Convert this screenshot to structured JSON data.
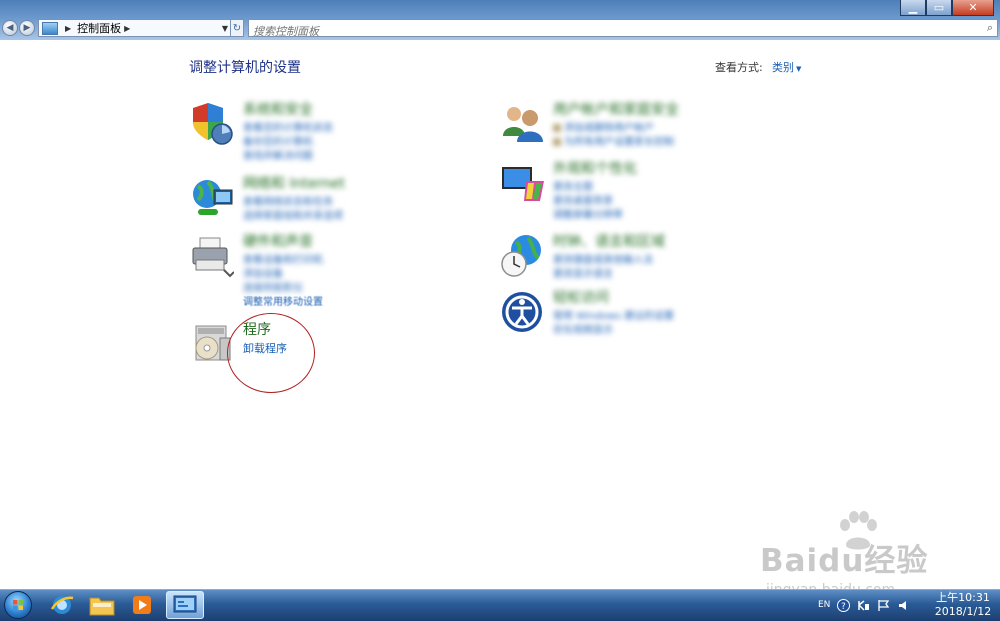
{
  "window": {
    "controls": [
      "minimize",
      "maximize",
      "close"
    ]
  },
  "address_bar": {
    "path": "控制面板",
    "placeholder": "搜索控制面板"
  },
  "header": {
    "title": "调整计算机的设置",
    "view_by_label": "查看方式:",
    "view_by_value": "类别"
  },
  "categories": {
    "security": {
      "title": "系统和安全",
      "links": [
        "查看您的计算机状态",
        "备份您的计算机",
        "查找并解决问题"
      ]
    },
    "network": {
      "title": "网络和 Internet",
      "links": [
        "查看网络状态和任务",
        "选择家庭组和共享选项"
      ]
    },
    "hardware": {
      "title": "硬件和声音",
      "links": [
        "查看设备和打印机",
        "添加设备",
        "连接到投影仪",
        "调整常用移动设置"
      ]
    },
    "programs": {
      "title": "程序",
      "links": [
        "卸载程序"
      ]
    },
    "accounts": {
      "title": "用户帐户和家庭安全",
      "links": [
        "添加或删除用户帐户",
        "为所有用户设置家长控制"
      ]
    },
    "appearance": {
      "title": "外观和个性化",
      "links": [
        "更改主题",
        "更改桌面背景",
        "调整屏幕分辨率"
      ]
    },
    "clock": {
      "title": "时钟、语言和区域",
      "links": [
        "更改键盘或其他输入法",
        "更改显示语言"
      ]
    },
    "ease": {
      "title": "轻松访问",
      "links": [
        "使用 Windows 建议的设置",
        "优化视频显示"
      ]
    }
  },
  "watermark": {
    "logo": "Baidu经验",
    "url": "jingyan.baidu.com"
  },
  "taskbar": {
    "language": "EN",
    "time": "上午10:31",
    "date": "2018/1/12"
  }
}
